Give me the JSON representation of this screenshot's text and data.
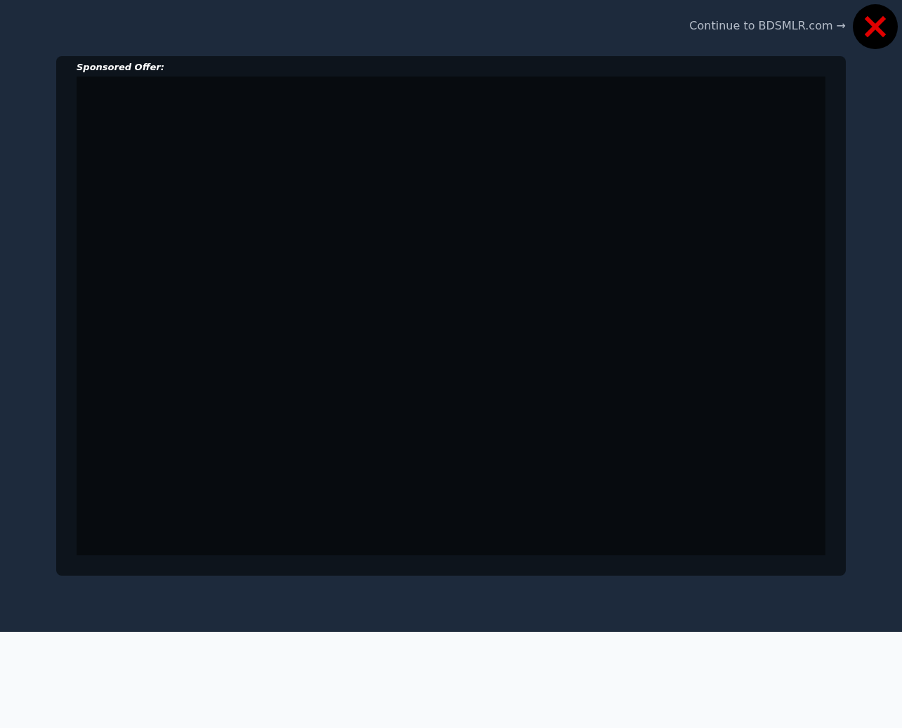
{
  "overlay": {
    "continue_link": "Continue to BDSMLR.com →"
  },
  "offer": {
    "label": "Sponsored Offer:"
  }
}
